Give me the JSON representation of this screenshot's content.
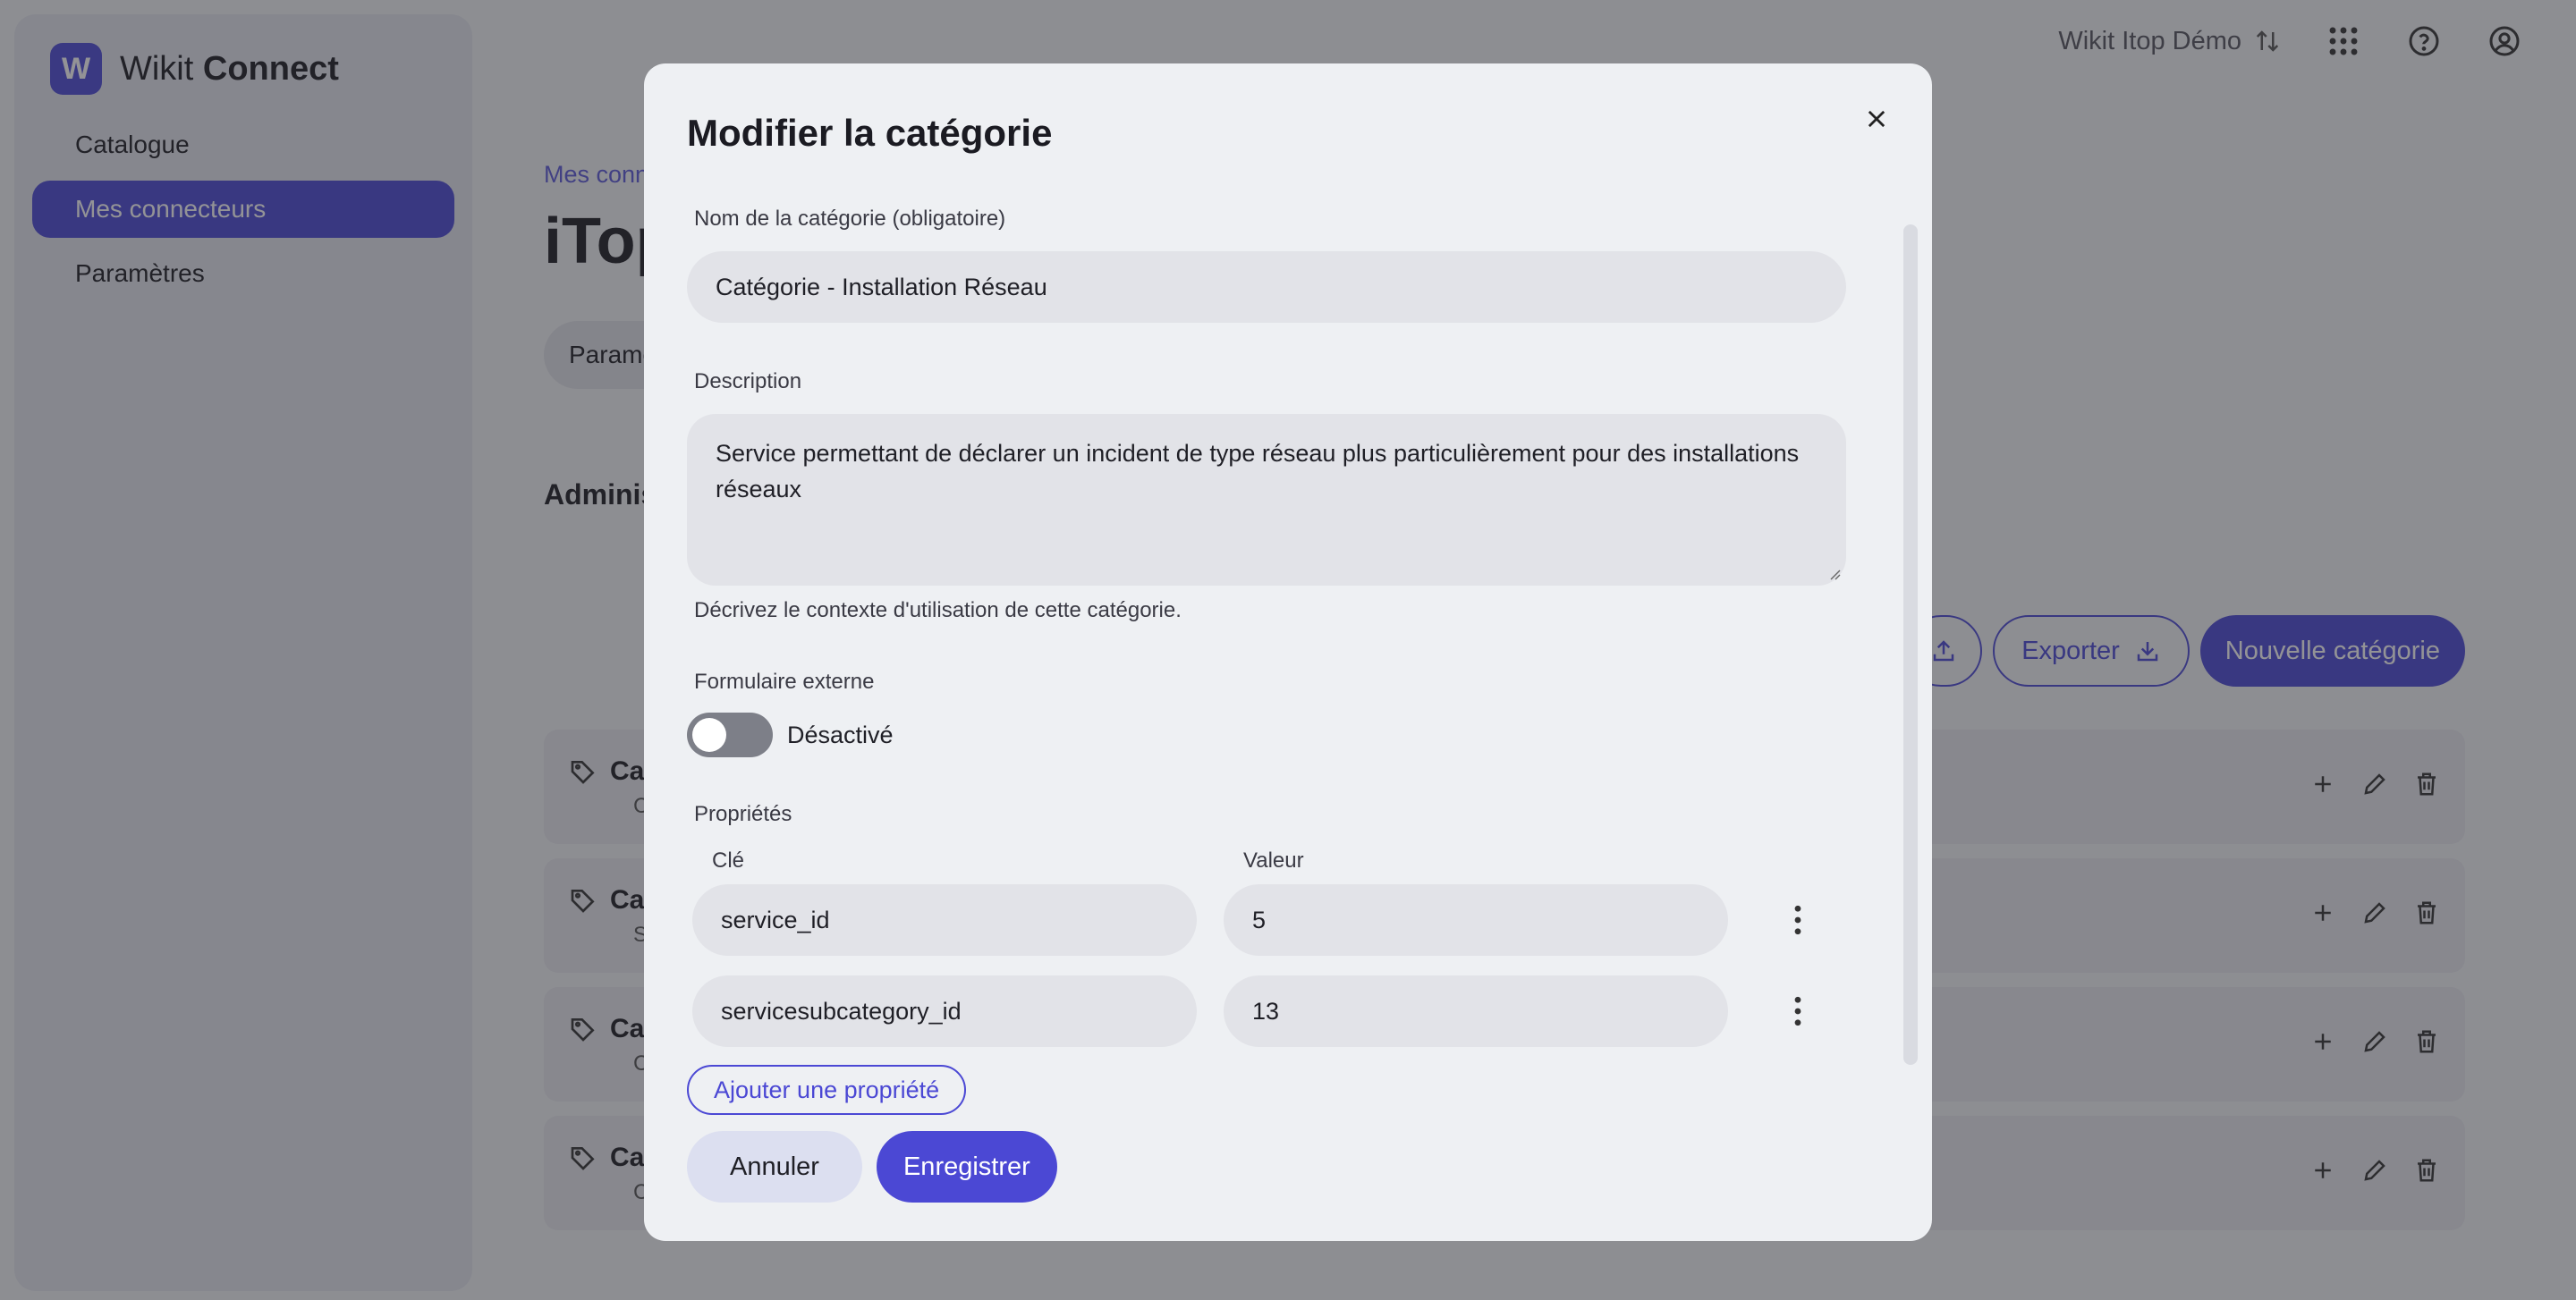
{
  "brand": {
    "logo_letter": "W",
    "name_light": "Wikit",
    "name_bold": "Connect"
  },
  "sidebar": {
    "items": [
      {
        "label": "Catalogue",
        "active": false
      },
      {
        "label": "Mes connecteurs",
        "active": true
      },
      {
        "label": "Paramètres",
        "active": false
      }
    ]
  },
  "topbar": {
    "workspace": "Wikit Itop Démo",
    "icons": [
      "swap-icon",
      "apps-grid-icon",
      "help-icon",
      "account-icon"
    ]
  },
  "main": {
    "breadcrumb": "Mes conn",
    "title": "iTop",
    "tab": "Parame",
    "section_title": "Adminis",
    "actions": {
      "export_label": "Exporter",
      "new_label": "Nouvelle catégorie"
    },
    "rows": [
      {
        "title": "Cat",
        "sub": "Cate"
      },
      {
        "title": "Cat",
        "sub": "Serv"
      },
      {
        "title": "Cat",
        "sub": "Con"
      },
      {
        "title": "Cat",
        "sub": "Cate"
      }
    ]
  },
  "modal": {
    "title": "Modifier la catégorie",
    "name_label": "Nom de la catégorie (obligatoire)",
    "name_value": "Catégorie - Installation Réseau",
    "description_label": "Description",
    "description_value": "Service permettant de déclarer un incident de type réseau plus particulièrement pour des installations réseaux",
    "description_help": "Décrivez le contexte d'utilisation de cette catégorie.",
    "external_form_label": "Formulaire externe",
    "external_form_state": "Désactivé",
    "properties_label": "Propriétés",
    "key_header": "Clé",
    "value_header": "Valeur",
    "properties": [
      {
        "key": "service_id",
        "value": "5"
      },
      {
        "key": "servicesubcategory_id",
        "value": "13"
      }
    ],
    "add_property_label": "Ajouter une propriété",
    "cancel_label": "Annuler",
    "save_label": "Enregistrer"
  },
  "colors": {
    "accent": "#4b48d4",
    "overlay": "rgba(40,40,46,0.5)"
  }
}
